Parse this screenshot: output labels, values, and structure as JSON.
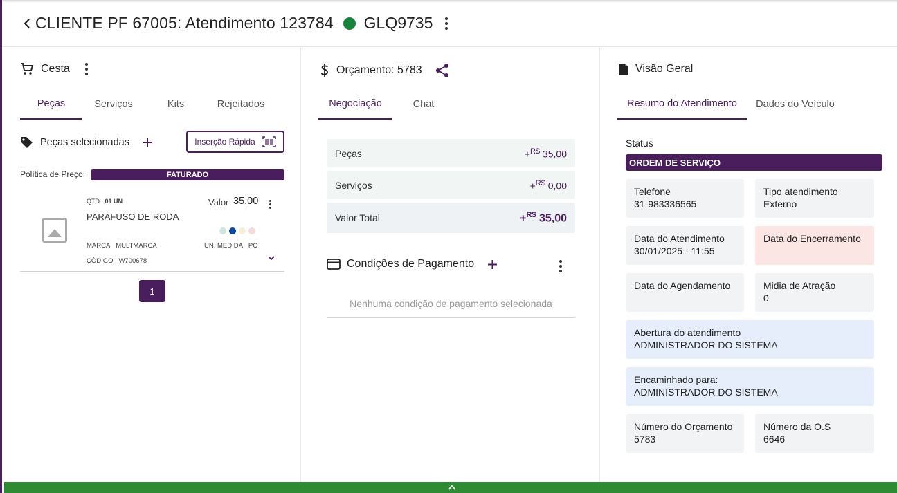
{
  "header": {
    "title": "CLIENTE PF 67005: Atendimento 123784",
    "plate": "GLQ9735",
    "status_color": "#17843b"
  },
  "cesta": {
    "title": "Cesta",
    "tabs": [
      "Peças",
      "Serviços",
      "Kits",
      "Rejeitados"
    ],
    "active_tab": "Peças",
    "selected_label": "Peças selecionadas",
    "quick_insert": "Inserção Rápida",
    "politica_label": "Política de Preço:",
    "politica_value": "FATURADO",
    "item": {
      "qtd_label": "QTD.",
      "qtd_value": "01 UN",
      "name": "PARAFUSO DE RODA",
      "valor_label": "Valor",
      "valor": "35,00",
      "marca_label": "MARCA",
      "marca": "MULTMARCA",
      "unmed_label": "UN. MEDIDA",
      "unmed": "PC",
      "codigo_label": "CÓDIGO",
      "codigo": "W700678",
      "swatches": [
        "#cfe6e0",
        "#0d47a1",
        "#f7efd5",
        "#f6d9d9"
      ]
    },
    "page": "1"
  },
  "orcamento": {
    "title": "Orçamento: 5783",
    "tabs": [
      "Negociação",
      "Chat"
    ],
    "active_tab": "Negociação",
    "rows": [
      {
        "label": "Peças",
        "currency": "R$",
        "value": "35,00"
      },
      {
        "label": "Serviços",
        "currency": "R$",
        "value": "0,00"
      },
      {
        "label": "Valor Total",
        "currency": "R$",
        "value": "35,00"
      }
    ],
    "sign": "+",
    "cond_title": "Condições de Pagamento",
    "cond_empty": "Nenhuma condição de pagamento selecionada"
  },
  "visao": {
    "title": "Visão Geral",
    "tabs": [
      "Resumo do Atendimento",
      "Dados do Veículo"
    ],
    "active_tab": "Resumo do Atendimento",
    "status_label": "Status",
    "status_value": "ORDEM DE SERVIÇO",
    "cards": {
      "telefone": {
        "label": "Telefone",
        "value": "31-983336565"
      },
      "tipo": {
        "label": "Tipo atendimento",
        "value": "Externo"
      },
      "data_atend": {
        "label": "Data do Atendimento",
        "value": "30/01/2025 - 11:55"
      },
      "data_enc": {
        "label": "Data do Encerramento",
        "value": ""
      },
      "data_agend": {
        "label": "Data do Agendamento",
        "value": ""
      },
      "midia": {
        "label": "Midia de Atração",
        "value": "0"
      },
      "abertura": {
        "label": "Abertura do atendimento",
        "value": "ADMINISTRADOR DO SISTEMA"
      },
      "encaminhado": {
        "label": "Encaminhado para:",
        "value": "ADMINISTRADOR DO SISTEMA"
      },
      "num_orc": {
        "label": "Número do Orçamento",
        "value": "5783"
      },
      "num_os": {
        "label": "Número da O.S",
        "value": "6646"
      }
    }
  },
  "colors": {
    "brand": "#4a1d5c",
    "footer": "#2e8a33"
  }
}
